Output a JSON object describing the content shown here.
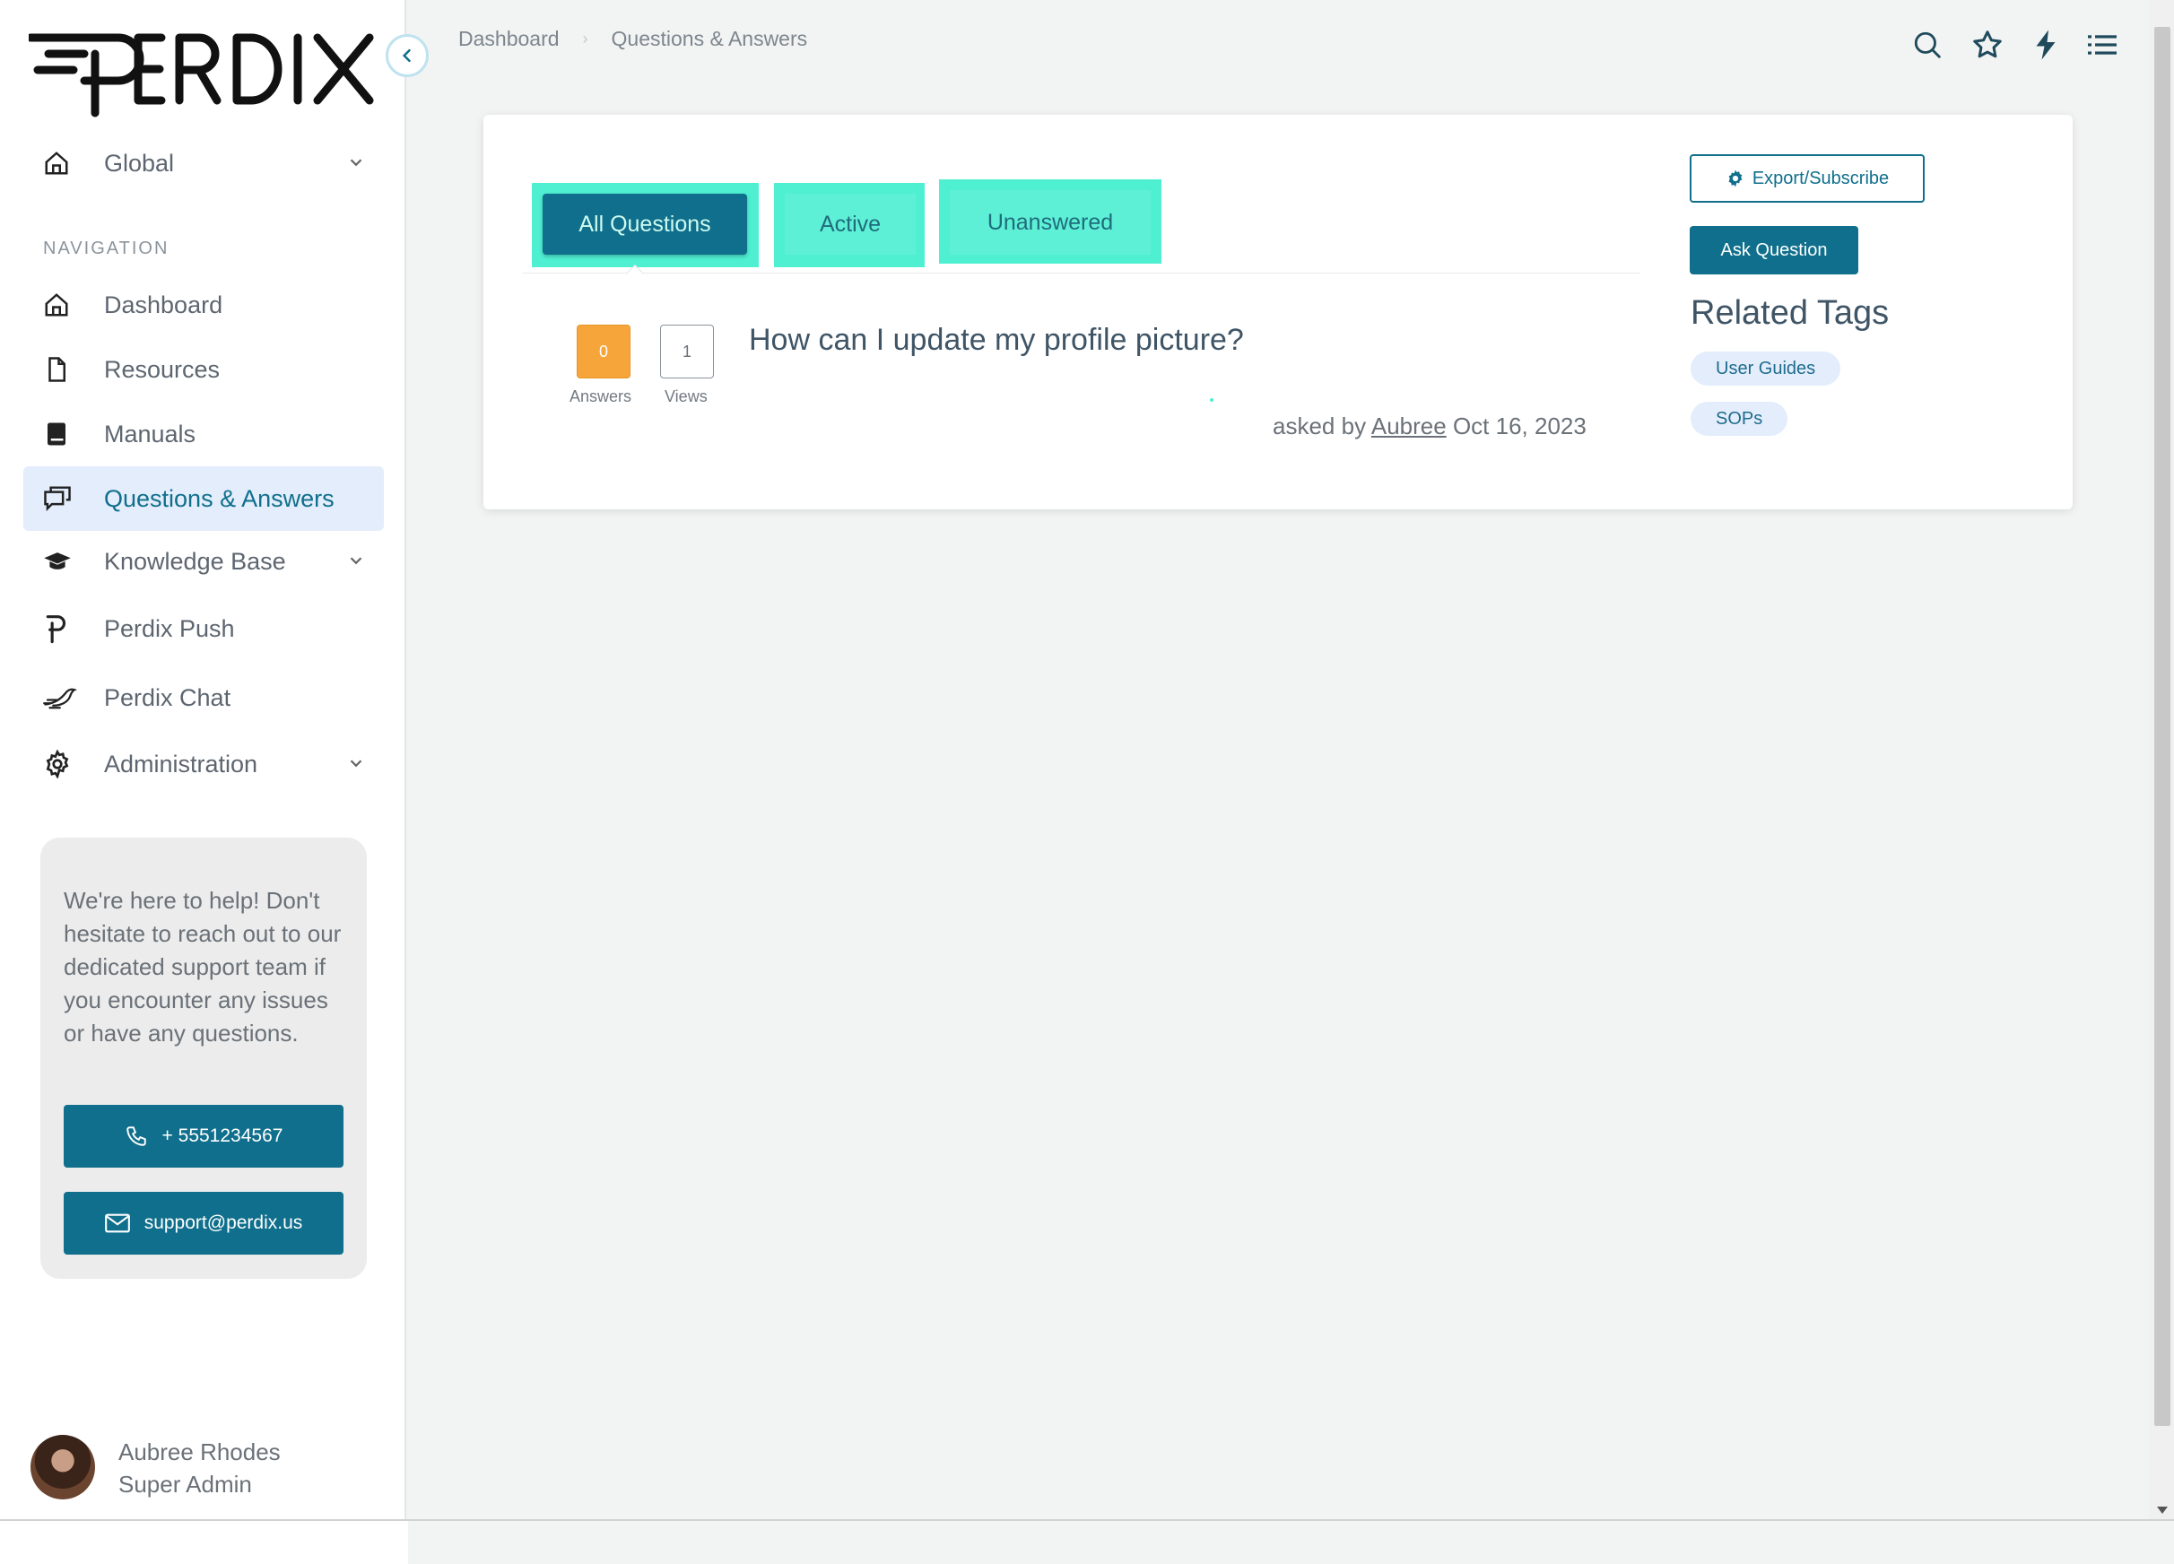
{
  "app": {
    "logo_text": "PERDIX"
  },
  "breadcrumb": {
    "items": [
      "Dashboard",
      "Questions & Answers"
    ]
  },
  "sidebar": {
    "workspace": "Global",
    "nav_heading": "NAVIGATION",
    "items": [
      {
        "label": "Dashboard",
        "icon": "home-icon"
      },
      {
        "label": "Resources",
        "icon": "file-icon"
      },
      {
        "label": "Manuals",
        "icon": "book-icon"
      },
      {
        "label": "Questions & Answers",
        "icon": "chat-icon",
        "active": true
      },
      {
        "label": "Knowledge Base",
        "icon": "graduation-cap-icon",
        "expandable": true
      },
      {
        "label": "Perdix Push",
        "icon": "perdix-p-icon"
      },
      {
        "label": "Perdix Chat",
        "icon": "bird-icon"
      },
      {
        "label": "Administration",
        "icon": "gear-icon",
        "expandable": true
      }
    ],
    "help": {
      "text": "We're here to help! Don't hesitate to reach out to our dedicated support team if you encounter any issues or have any questions.",
      "phone": "+ 5551234567",
      "email": "support@perdix.us"
    },
    "user": {
      "name": "Aubree Rhodes",
      "role": "Super Admin"
    }
  },
  "topbar": {
    "icons": [
      "search-icon",
      "star-icon",
      "bolt-icon",
      "list-icon"
    ]
  },
  "qa": {
    "tabs": [
      "All Questions",
      "Active",
      "Unanswered"
    ],
    "selected_tab": "All Questions",
    "questions": [
      {
        "answers": "0",
        "answers_label": "Answers",
        "views": "1",
        "views_label": "Views",
        "title": "How can I update my profile picture?",
        "asked_prefix": "asked by",
        "asked_by": "Aubree",
        "date": "Oct 16, 2023"
      }
    ],
    "export_label": "Export/Subscribe",
    "ask_label": "Ask Question",
    "related_tags_title": "Related Tags",
    "tags": [
      "User Guides",
      "SOPs"
    ]
  },
  "colors": {
    "primary": "#0f6f8c",
    "highlight": "#4ff0d2",
    "answers_badge": "#f5a53a",
    "active_nav_bg": "#e3edfb"
  }
}
